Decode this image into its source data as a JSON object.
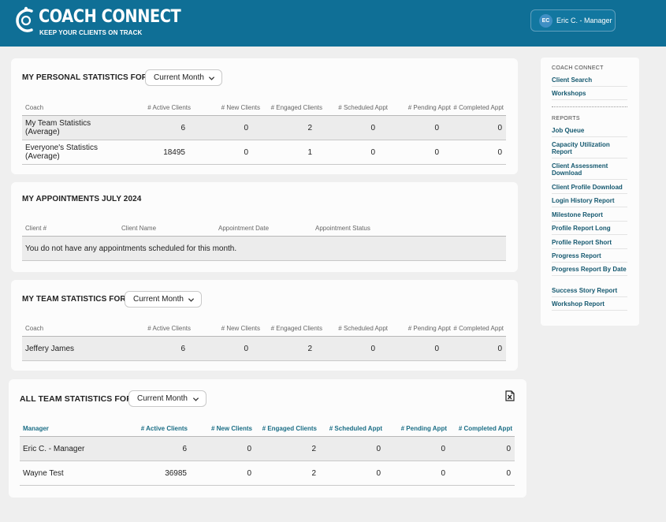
{
  "header": {
    "brand": "COACH CONNECT",
    "tagline": "KEEP YOUR CLIENTS ON TRACK",
    "user_initials": "EC",
    "user_name": "Eric C. - Manager"
  },
  "personal": {
    "title": "MY PERSONAL STATISTICS FOR:",
    "period": "Current Month",
    "columns": [
      "Coach",
      "# Active Clients",
      "# New Clients",
      "# Engaged Clients",
      "# Scheduled Appt",
      "# Pending Appt",
      "# Completed Appt"
    ],
    "rows": [
      {
        "name": "My Team Statistics (Average)",
        "active": "6",
        "new": "0",
        "engaged": "2",
        "scheduled": "0",
        "pending": "0",
        "completed": "0"
      },
      {
        "name": "Everyone's Statistics (Average)",
        "active": "18495",
        "new": "0",
        "engaged": "1",
        "scheduled": "0",
        "pending": "0",
        "completed": "0"
      }
    ]
  },
  "appointments": {
    "title": "MY APPOINTMENTS JULY 2024",
    "columns": [
      "Client #",
      "Client Name",
      "Appointment Date",
      "Appointment Status"
    ],
    "empty_message": "You do not have any appointments scheduled for this month."
  },
  "team": {
    "title": "MY TEAM STATISTICS FOR:",
    "period": "Current Month",
    "columns": [
      "Coach",
      "# Active Clients",
      "# New Clients",
      "# Engaged Clients",
      "# Scheduled Appt",
      "# Pending Appt",
      "# Completed Appt"
    ],
    "rows": [
      {
        "name": "Jeffery James",
        "active": "6",
        "new": "0",
        "engaged": "2",
        "scheduled": "0",
        "pending": "0",
        "completed": "0"
      }
    ]
  },
  "all_team": {
    "title": "ALL TEAM STATISTICS FOR:",
    "period": "Current Month",
    "columns": [
      "Manager",
      "# Active Clients",
      "# New Clients",
      "# Engaged Clients",
      "# Scheduled Appt",
      "# Pending Appt",
      "# Completed Appt"
    ],
    "rows": [
      {
        "name": "Eric C. - Manager",
        "active": "6",
        "new": "0",
        "engaged": "2",
        "scheduled": "0",
        "pending": "0",
        "completed": "0"
      },
      {
        "name": "Wayne Test",
        "active": "36985",
        "new": "0",
        "engaged": "2",
        "scheduled": "0",
        "pending": "0",
        "completed": "0"
      }
    ]
  },
  "sidebar": {
    "section1": "COACH CONNECT",
    "links1": [
      "Client Search",
      "Workshops"
    ],
    "section2": "REPORTS",
    "links2": [
      "Job Queue",
      "Capacity Utilization Report",
      "Client Assessment Download",
      "Client Profile Download",
      "Login History Report",
      "Milestone Report",
      "Profile Report Long",
      "Profile Report Short",
      "Progress Report",
      "Progress Report By Date",
      "Success Story Report",
      "Workshop Report"
    ]
  },
  "colors": {
    "header_bg": "#0f6f96",
    "link": "#14586f",
    "teal_header": "#1b6e86"
  },
  "icons": [
    "coach-connect-logo-icon",
    "chevron-down-icon",
    "excel-export-icon"
  ]
}
